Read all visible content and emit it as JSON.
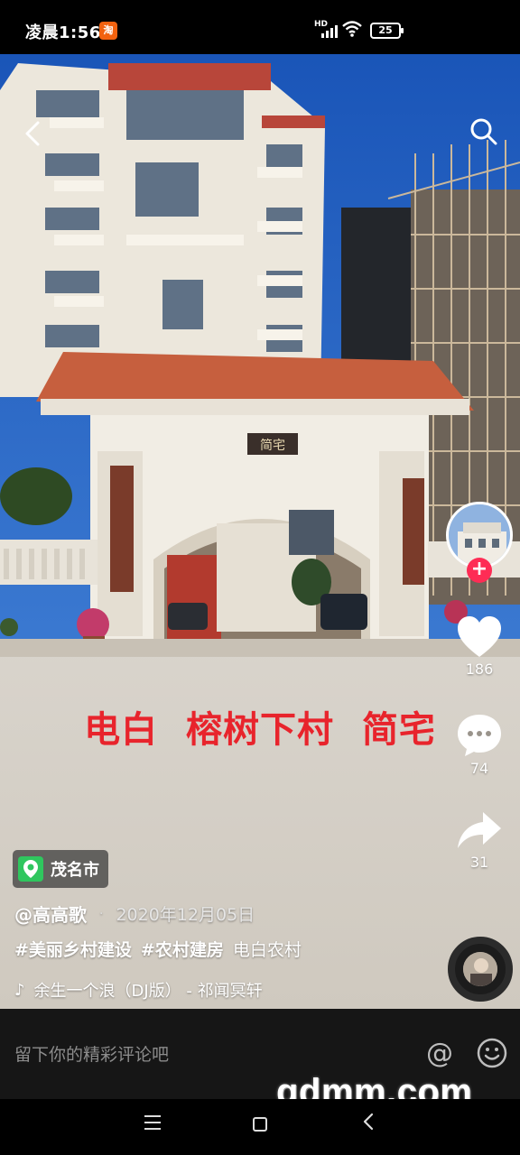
{
  "status_bar": {
    "time": "凌晨1:56",
    "notification_badge": "淘",
    "network": "HD",
    "battery": "25"
  },
  "video": {
    "overlay_text": [
      "电白",
      "榕树下村",
      "简宅"
    ],
    "gate_sign": "简宅",
    "icons": {
      "back": "chevron-left-icon",
      "search": "search-icon"
    }
  },
  "rail": {
    "follow_label": "+",
    "likes": "186",
    "comments": "74",
    "shares": "31"
  },
  "post": {
    "location": "茂名市",
    "author": "@高高歌",
    "separator": "·",
    "date": "2020年12月05日",
    "tags": [
      "#美丽乡村建设",
      "#农村建房"
    ],
    "caption_text": "电白农村",
    "music_icon": "♪",
    "music": "余生一个浪（DJ版） - 祁闻冥轩"
  },
  "comment_bar": {
    "placeholder": "留下你的精彩评论吧",
    "at_symbol": "@"
  },
  "watermark": "gdmm.com",
  "colors": {
    "accent_red": "#fe2c55",
    "overlay_red": "#e8242c",
    "location_green": "#2fc65e"
  }
}
